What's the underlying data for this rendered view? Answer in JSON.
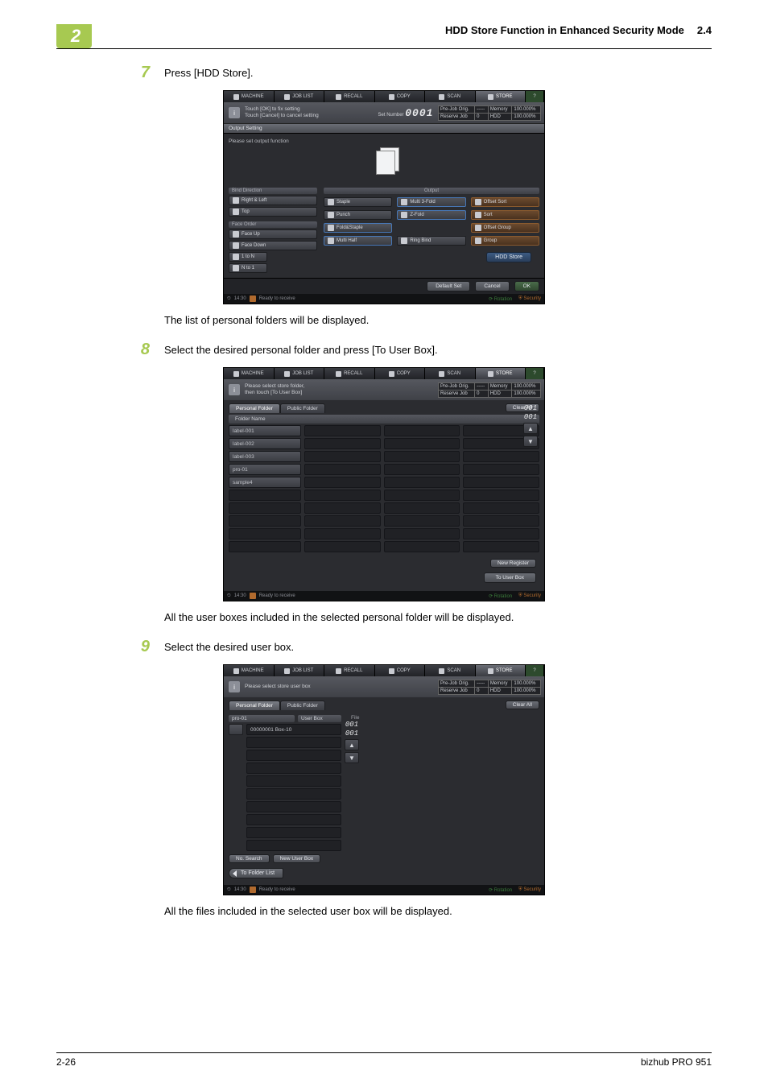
{
  "page": {
    "side_tab": "2",
    "header_title": "HDD Store Function in Enhanced Security Mode",
    "header_section": "2.4",
    "footer_left": "2-26",
    "footer_right": "bizhub PRO 951"
  },
  "steps": {
    "s7_num": "7",
    "s7_text": "Press [HDD Store].",
    "s7_caption": "The list of personal folders will be displayed.",
    "s8_num": "8",
    "s8_text": "Select the desired personal folder and press [To User Box].",
    "s8_caption": "All the user boxes included in the selected personal folder will be displayed.",
    "s9_num": "9",
    "s9_text": "Select the desired user box.",
    "s9_caption": "All the files included in the selected user box will be displayed."
  },
  "tabs": {
    "machine": "MACHINE",
    "joblist": "JOB LIST",
    "recall": "RECALL",
    "copy": "COPY",
    "scan": "SCAN",
    "store": "STORE"
  },
  "info": {
    "s7_msg": "Touch [OK] to fix setting\nTouch [Cancel] to cancel setting",
    "s8_msg": "Please select store folder,\nthen touch [To User Box]",
    "s9_msg": "Please select store user box",
    "setnum_label": "Set Number",
    "setnum_value": "0001"
  },
  "resbox": {
    "r1a": "Pre-Job Orig.",
    "r1b": "-----",
    "r1c": "Memory",
    "r1d": "100.000%",
    "r2a": "Reserve Job",
    "r2b": "0",
    "r2c": "HDD",
    "r2d": "100.000%"
  },
  "shot1": {
    "section_bar": "Output Setting",
    "msg": "Please set output function",
    "bind_hdr": "Bind Direction",
    "bind_opts": [
      "Right & Left",
      "Top"
    ],
    "face_hdr": "Face Order",
    "face_opts": [
      "Face Up",
      "Face Down"
    ],
    "order_opts": [
      "1 to N",
      "N to 1"
    ],
    "output_hdr": "Output",
    "grid": [
      "Staple",
      "Multi 3-Fold",
      "Offset Sort",
      "Punch",
      "Z-Fold",
      "Sort",
      "Fold&Staple",
      "",
      "Offset Group",
      "Multi Half",
      "Ring Bind",
      "Group"
    ],
    "hdd_btn": "HDD Store",
    "bottom": {
      "default": "Default Set",
      "cancel": "Cancel",
      "ok": "OK"
    }
  },
  "shot2": {
    "tab_personal": "Personal Folder",
    "tab_public": "Public Folder",
    "clear": "Clear All",
    "col_header": "Folder Name",
    "folders": [
      "label-001",
      "label-002",
      "label-003",
      "pro-01",
      "sample4"
    ],
    "page_ind": {
      "cur": "001",
      "tot": "001"
    },
    "new_reg": "New Register",
    "to_user_box": "To User Box"
  },
  "shot3": {
    "tab_personal": "Personal Folder",
    "tab_public": "Public Folder",
    "clear": "Clear All",
    "left_hdr1": "pro-01",
    "left_hdr2": "User Box",
    "box_item": "00000001 Box-10",
    "page_ind": {
      "cur": "001",
      "tot": "001"
    },
    "file_hdr": "File",
    "btn_nosearch": "No. Search",
    "btn_newbox": "New User Box",
    "btn_back": "To Folder List"
  },
  "status": {
    "time": "14:30",
    "ready": "Ready to receive",
    "rotation": "Rotation",
    "security": "Security"
  }
}
